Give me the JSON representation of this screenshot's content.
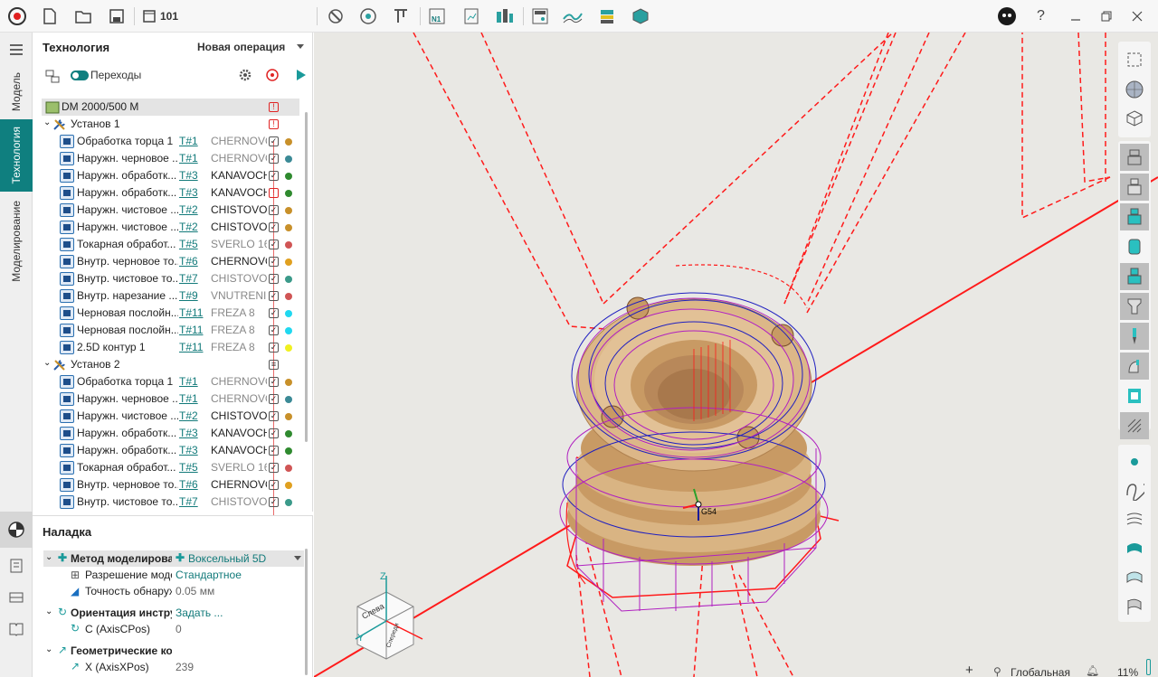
{
  "toolbar": {
    "doc_name": "101",
    "icons": [
      "logo-icon",
      "new-file-icon",
      "open-folder-icon",
      "save-icon",
      "window-icon",
      "tool-icon",
      "camera-icon",
      "caliper-icon",
      "nc-icon",
      "report-icon",
      "simulation-icon",
      "machine-icon",
      "chart-icon",
      "stock-icon",
      "box-icon"
    ],
    "help_label": "?",
    "window_controls": [
      "minimize",
      "restore",
      "close"
    ]
  },
  "vtabs": {
    "model": "Модель",
    "technology": "Технология",
    "modeling": "Моделирование"
  },
  "tech": {
    "title": "Технология",
    "new_op": "Новая операция",
    "transitions_label": "Переходы",
    "machine": "DM 2000/500 M",
    "setups": [
      {
        "label": "Установ 1",
        "ops": [
          {
            "name": "Обработка торца 1",
            "tool": "T#1",
            "tool_name": "CHERNOVO",
            "dark": false,
            "warn": false,
            "color": "#c8902a"
          },
          {
            "name": "Наружн. черновое ...",
            "tool": "T#1",
            "tool_name": "CHERNOVO",
            "dark": false,
            "warn": false,
            "color": "#3b8a96"
          },
          {
            "name": "Наружн. обработк...",
            "tool": "T#3",
            "tool_name": "KANAVOCH",
            "dark": true,
            "warn": false,
            "color": "#2f8a2f"
          },
          {
            "name": "Наружн. обработк...",
            "tool": "T#3",
            "tool_name": "KANAVOCH",
            "dark": true,
            "warn": true,
            "color": "#2f8a2f"
          },
          {
            "name": "Наружн. чистовое ...",
            "tool": "T#2",
            "tool_name": "CHISTOVOI",
            "dark": true,
            "warn": false,
            "color": "#c8902a"
          },
          {
            "name": "Наружн. чистовое ...",
            "tool": "T#2",
            "tool_name": "CHISTOVOI",
            "dark": true,
            "warn": false,
            "color": "#c8902a"
          },
          {
            "name": "Токарная обработ...",
            "tool": "T#5",
            "tool_name": "SVERLO 16",
            "dark": false,
            "warn": false,
            "color": "#d05555"
          },
          {
            "name": "Внутр. черновое то...",
            "tool": "T#6",
            "tool_name": "CHERNOVO",
            "dark": true,
            "warn": false,
            "color": "#e0a020"
          },
          {
            "name": "Внутр. чистовое то...",
            "tool": "T#7",
            "tool_name": "CHISTOVOI",
            "dark": false,
            "warn": false,
            "color": "#3b9a8a"
          },
          {
            "name": "Внутр. нарезание ...",
            "tool": "T#9",
            "tool_name": "VNUTRENII",
            "dark": false,
            "warn": false,
            "color": "#d05555"
          },
          {
            "name": "Черновая послойн...",
            "tool": "T#11",
            "tool_name": "FREZA 8",
            "dark": false,
            "warn": false,
            "color": "#20d8f0"
          },
          {
            "name": "Черновая послойн...",
            "tool": "T#11",
            "tool_name": "FREZA 8",
            "dark": false,
            "warn": false,
            "color": "#20d8f0"
          },
          {
            "name": "2.5D контур 1",
            "tool": "T#11",
            "tool_name": "FREZA 8",
            "dark": false,
            "warn": false,
            "color": "#f0f020"
          }
        ]
      },
      {
        "label": "Установ 2",
        "ops": [
          {
            "name": "Обработка торца 1",
            "tool": "T#1",
            "tool_name": "CHERNOVO",
            "dark": false,
            "warn": false,
            "color": "#c8902a"
          },
          {
            "name": "Наружн. черновое ...",
            "tool": "T#1",
            "tool_name": "CHERNOVO",
            "dark": false,
            "warn": false,
            "color": "#3b8a96"
          },
          {
            "name": "Наружн. чистовое ...",
            "tool": "T#2",
            "tool_name": "CHISTOVOI",
            "dark": true,
            "warn": false,
            "color": "#c8902a"
          },
          {
            "name": "Наружн. обработк...",
            "tool": "T#3",
            "tool_name": "KANAVOCH",
            "dark": true,
            "warn": false,
            "color": "#2f8a2f"
          },
          {
            "name": "Наружн. обработк...",
            "tool": "T#3",
            "tool_name": "KANAVOCH",
            "dark": true,
            "warn": false,
            "color": "#2f8a2f"
          },
          {
            "name": "Токарная обработ...",
            "tool": "T#5",
            "tool_name": "SVERLO 16",
            "dark": false,
            "warn": false,
            "color": "#d05555"
          },
          {
            "name": "Внутр. черновое то...",
            "tool": "T#6",
            "tool_name": "CHERNOVO",
            "dark": true,
            "warn": false,
            "color": "#e0a020"
          },
          {
            "name": "Внутр. чистовое то...",
            "tool": "T#7",
            "tool_name": "CHISTOVOI",
            "dark": false,
            "warn": false,
            "color": "#3b9a8a"
          }
        ]
      }
    ]
  },
  "naladka": {
    "title": "Наладка",
    "method_label": "Метод моделирова",
    "method_value": "Воксельный 5D",
    "resolution_label": "Разрешение моде",
    "resolution_value": "Стандартное",
    "accuracy_label": "Точность обнаруж",
    "accuracy_value": "0.05 мм",
    "orientation_label": "Ориентация инстру",
    "orientation_value": "Задать ...",
    "c_label": "C (AxisCPos)",
    "c_value": "0",
    "geo_label": "Геометрические ко",
    "x_label": "X (AxisXPos)",
    "x_value": "239"
  },
  "viewport": {
    "cube_left": "Слева",
    "cube_front": "Спереди",
    "axis_z": "Z",
    "axis_y": "Y",
    "g54": "G54",
    "status_plus": "+",
    "status_cs": "Глобальная С",
    "zoom": "11%"
  },
  "colors": {
    "teal": "#0f7f7f",
    "toolpath_red": "#ff1a1a",
    "toolpath_magenta": "#b020c0",
    "part": "#d9b483"
  }
}
